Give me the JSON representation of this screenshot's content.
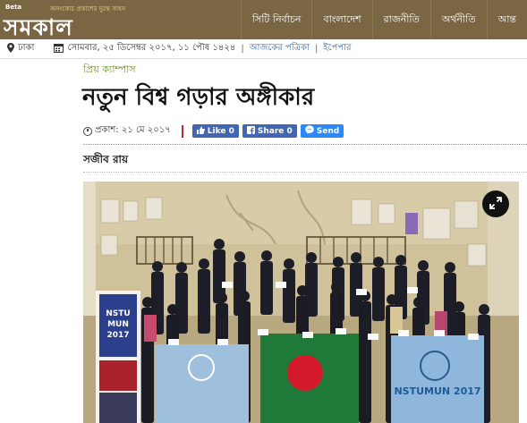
{
  "header": {
    "beta": "Beta",
    "tagline": "অসংকোচ প্রকাশের দুরন্ত সাহস",
    "logo": "সমকাল",
    "nav": [
      "সিটি নির্বাচন",
      "বাংলাদেশ",
      "রাজনীতি",
      "অর্থনীতি",
      "আন্ত"
    ]
  },
  "datebar": {
    "location": "ঢাকা",
    "date": "সোমবার, ২৫ ডিসেম্বর ২০১৭,  ১১ পৌষ ১৪২৪",
    "todays_paper": "আজকের পত্রিকা",
    "epaper": "ইপেপার"
  },
  "article": {
    "category": "প্রিয় ক্যাম্পাস",
    "title": "নতুন বিশ্ব গড়ার অঙ্গীকার",
    "published": "প্রকাশ: ২১ মে ২০১৭",
    "author": "সজীব রায়"
  },
  "share": {
    "like": "Like 0",
    "share": "Share 0",
    "send": "Send"
  },
  "photo": {
    "banner_title": "NSTU MUN 2017",
    "flag_text": "NSTUMUN 2017"
  },
  "colors": {
    "brand": "#7a6642",
    "accent_red": "#c0262d",
    "facebook": "#4267b2",
    "messenger": "#2a88ff",
    "category": "#6b8e2b"
  },
  "icons": [
    "location-icon",
    "calendar-icon",
    "clock-icon",
    "thumbs-up-icon",
    "facebook-icon",
    "messenger-icon",
    "expand-icon"
  ]
}
